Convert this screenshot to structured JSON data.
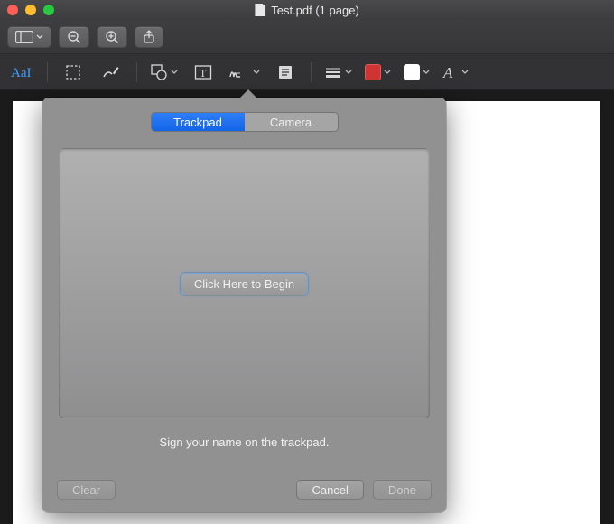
{
  "window": {
    "title": "Test.pdf (1 page)"
  },
  "popover": {
    "tabs": {
      "trackpad": "Trackpad",
      "camera": "Camera"
    },
    "begin": "Click Here to Begin",
    "hint": "Sign your name on the trackpad.",
    "buttons": {
      "clear": "Clear",
      "cancel": "Cancel",
      "done": "Done"
    }
  },
  "colors": {
    "accent": "#1f6fe8",
    "border_red": "#d13434",
    "fill_white": "#ffffff"
  }
}
